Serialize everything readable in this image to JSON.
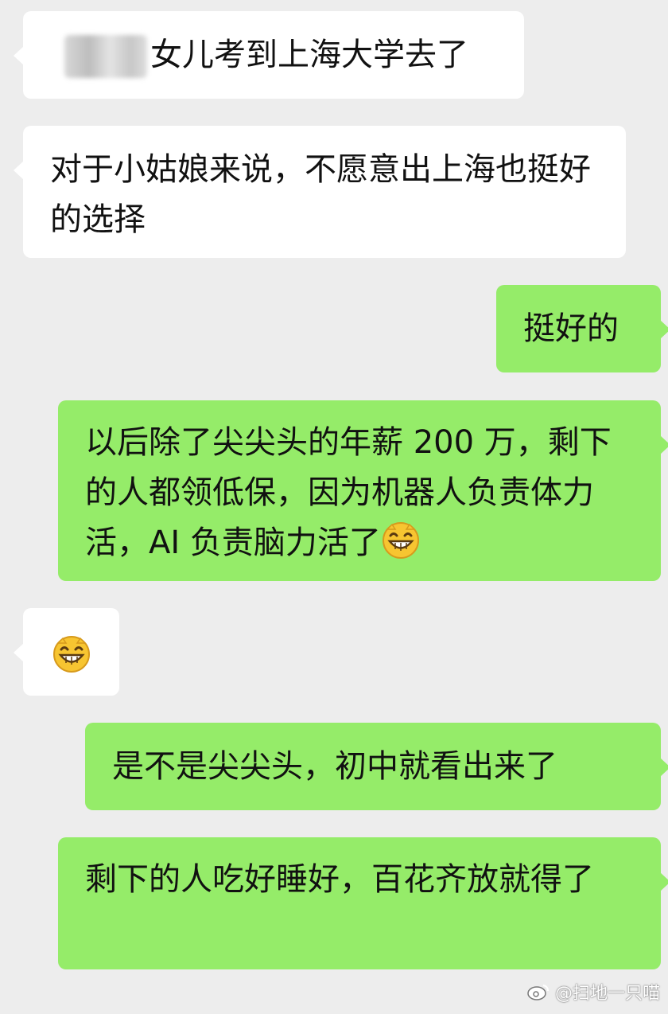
{
  "messages": [
    {
      "side": "left",
      "text": "女儿考到上海大学去了",
      "has_blurred_name": true
    },
    {
      "side": "left",
      "text": "对于小姑娘来说，不愿意出上海也挺好的选择"
    },
    {
      "side": "right",
      "text": "挺好的"
    },
    {
      "side": "right",
      "text": "以后除了尖尖头的年薪 200 万，剩下的人都领低保，因为机器人负责体力活，AI 负责脑力活了",
      "trailing_emoji": "grin-emoji"
    },
    {
      "side": "left",
      "text": "",
      "emoji": "grin-emoji"
    },
    {
      "side": "right",
      "text": "是不是尖尖头，初中就看出来了"
    },
    {
      "side": "right",
      "text": "剩下的人吃好睡好，百花齐放就得了"
    }
  ],
  "watermark": {
    "text": "@扫地一只喵",
    "icon": "weibo-logo-icon"
  },
  "colors": {
    "background": "#ededed",
    "left_bubble": "#ffffff",
    "right_bubble": "#95ec69",
    "text": "#111111"
  }
}
